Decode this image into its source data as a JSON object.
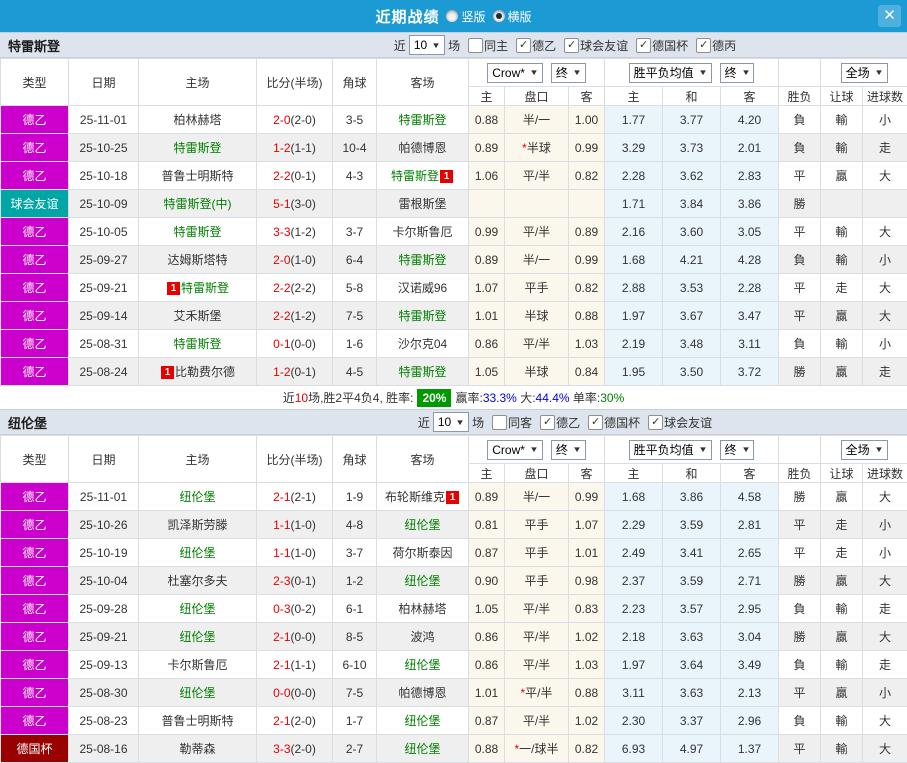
{
  "titlebar": {
    "title": "近期战绩",
    "view_options": [
      {
        "label": "竖版",
        "selected": false
      },
      {
        "label": "横版",
        "selected": true
      }
    ],
    "close_icon": "✕"
  },
  "colors": {
    "accent_blue": "#1c9ad4",
    "team_highlight_green": "#008000",
    "score_red": "#e60000",
    "result_red": "#e60000",
    "result_green": "#008000",
    "result_blue": "#0000dd",
    "rate_badge_green": "#009900",
    "league_colors": {
      "德乙": "#cc00cc",
      "球会友谊": "#00a6a6",
      "德国杯": "#990000"
    },
    "result_colors": {
      "勝": "red",
      "負": "green",
      "平": "blue",
      "贏": "red",
      "輸": "green",
      "走": "blue",
      "大": "red",
      "小": "green"
    }
  },
  "table_header": {
    "main_cols": [
      "类型",
      "日期",
      "主场",
      "比分(半场)",
      "角球",
      "客场"
    ],
    "odds_dropdown": "Crow*",
    "odds_final_dropdown": "终",
    "avg_dropdown": "胜平负均值",
    "avg_final_dropdown": "终",
    "scope_dropdown": "全场",
    "sub_cols": [
      "主",
      "盘口",
      "客",
      "主",
      "和",
      "客",
      "胜负",
      "让球",
      "进球数"
    ]
  },
  "sections": [
    {
      "team": "特雷斯登",
      "filters": {
        "near_label": "近",
        "matches_value": "10",
        "matches_suffix": "场",
        "venue": {
          "label": "同主",
          "checked": false
        },
        "leagues": [
          {
            "label": "德乙",
            "checked": true
          },
          {
            "label": "球会友谊",
            "checked": true
          },
          {
            "label": "德国杯",
            "checked": true
          },
          {
            "label": "德丙",
            "checked": true
          }
        ]
      },
      "rows": [
        {
          "league": "德乙",
          "date": "25-11-01",
          "home": {
            "name": "柏林赫塔",
            "highlight": false
          },
          "score": "2-0",
          "half": "(2-0)",
          "corners": "3-5",
          "away": {
            "name": "特雷斯登",
            "highlight": true
          },
          "odds": [
            "0.88",
            "半/一",
            "1.00"
          ],
          "avg": [
            "1.77",
            "3.77",
            "4.20"
          ],
          "results": [
            "負",
            "輸",
            "小"
          ]
        },
        {
          "league": "德乙",
          "date": "25-10-25",
          "home": {
            "name": "特雷斯登",
            "highlight": true
          },
          "score": "1-2",
          "half": "(1-1)",
          "corners": "10-4",
          "away": {
            "name": "帕德博恩",
            "highlight": false
          },
          "odds": [
            "0.89",
            "*半球",
            "0.99"
          ],
          "avg": [
            "3.29",
            "3.73",
            "2.01"
          ],
          "results": [
            "負",
            "輸",
            "走"
          ]
        },
        {
          "league": "德乙",
          "date": "25-10-18",
          "home": {
            "name": "普鲁士明斯特",
            "highlight": false
          },
          "score": "2-2",
          "half": "(0-1)",
          "corners": "4-3",
          "away": {
            "name": "特雷斯登",
            "highlight": true,
            "badge": "1",
            "badge_position": "after"
          },
          "odds": [
            "1.06",
            "平/半",
            "0.82"
          ],
          "avg": [
            "2.28",
            "3.62",
            "2.83"
          ],
          "results": [
            "平",
            "贏",
            "大"
          ]
        },
        {
          "league": "球会友谊",
          "date": "25-10-09",
          "home": {
            "name": "特雷斯登(中)",
            "highlight": true
          },
          "score": "5-1",
          "half": "(3-0)",
          "corners": "",
          "away": {
            "name": "雷根斯堡",
            "highlight": false
          },
          "odds": [
            "",
            "",
            ""
          ],
          "avg": [
            "1.71",
            "3.84",
            "3.86"
          ],
          "results": [
            "勝",
            "",
            ""
          ]
        },
        {
          "league": "德乙",
          "date": "25-10-05",
          "home": {
            "name": "特雷斯登",
            "highlight": true
          },
          "score": "3-3",
          "half": "(1-2)",
          "corners": "3-7",
          "away": {
            "name": "卡尔斯鲁厄",
            "highlight": false
          },
          "odds": [
            "0.99",
            "平/半",
            "0.89"
          ],
          "avg": [
            "2.16",
            "3.60",
            "3.05"
          ],
          "results": [
            "平",
            "輸",
            "大"
          ]
        },
        {
          "league": "德乙",
          "date": "25-09-27",
          "home": {
            "name": "达姆斯塔特",
            "highlight": false
          },
          "score": "2-0",
          "half": "(1-0)",
          "corners": "6-4",
          "away": {
            "name": "特雷斯登",
            "highlight": true
          },
          "odds": [
            "0.89",
            "半/一",
            "0.99"
          ],
          "avg": [
            "1.68",
            "4.21",
            "4.28"
          ],
          "results": [
            "負",
            "輸",
            "小"
          ]
        },
        {
          "league": "德乙",
          "date": "25-09-21",
          "home": {
            "name": "特雷斯登",
            "highlight": true,
            "badge": "1",
            "badge_position": "before"
          },
          "score": "2-2",
          "half": "(2-2)",
          "corners": "5-8",
          "away": {
            "name": "汉诺威96",
            "highlight": false
          },
          "odds": [
            "1.07",
            "平手",
            "0.82"
          ],
          "avg": [
            "2.88",
            "3.53",
            "2.28"
          ],
          "results": [
            "平",
            "走",
            "大"
          ]
        },
        {
          "league": "德乙",
          "date": "25-09-14",
          "home": {
            "name": "艾禾斯堡",
            "highlight": false
          },
          "score": "2-2",
          "half": "(1-2)",
          "corners": "7-5",
          "away": {
            "name": "特雷斯登",
            "highlight": true
          },
          "odds": [
            "1.01",
            "半球",
            "0.88"
          ],
          "avg": [
            "1.97",
            "3.67",
            "3.47"
          ],
          "results": [
            "平",
            "贏",
            "大"
          ]
        },
        {
          "league": "德乙",
          "date": "25-08-31",
          "home": {
            "name": "特雷斯登",
            "highlight": true
          },
          "score": "0-1",
          "half": "(0-0)",
          "corners": "1-6",
          "away": {
            "name": "沙尔克04",
            "highlight": false
          },
          "odds": [
            "0.86",
            "平/半",
            "1.03"
          ],
          "avg": [
            "2.19",
            "3.48",
            "3.11"
          ],
          "results": [
            "負",
            "輸",
            "小"
          ]
        },
        {
          "league": "德乙",
          "date": "25-08-24",
          "home": {
            "name": "比勒费尔德",
            "highlight": false,
            "badge": "1",
            "badge_position": "before"
          },
          "score": "1-2",
          "half": "(0-1)",
          "corners": "4-5",
          "away": {
            "name": "特雷斯登",
            "highlight": true
          },
          "odds": [
            "1.05",
            "半球",
            "0.84"
          ],
          "avg": [
            "1.95",
            "3.50",
            "3.72"
          ],
          "results": [
            "勝",
            "贏",
            "走"
          ]
        }
      ],
      "summary": {
        "parts": [
          {
            "text": "近",
            "color": "#333333"
          },
          {
            "text": "10",
            "color": "#e60000"
          },
          {
            "text": "场,胜2平4负4, 胜率:",
            "color": "#333333"
          },
          {
            "text": "20%",
            "style": "badge"
          },
          {
            "text": "赢率:",
            "color": "#333333"
          },
          {
            "text": "33.3%",
            "color": "#0000dd"
          },
          {
            "text": " 大:",
            "color": "#333333"
          },
          {
            "text": "44.4%",
            "color": "#0000dd"
          },
          {
            "text": " 单率:",
            "color": "#333333"
          },
          {
            "text": "30%",
            "color": "#008000"
          }
        ]
      }
    },
    {
      "team": "纽伦堡",
      "filters": {
        "near_label": "近",
        "matches_value": "10",
        "matches_suffix": "场",
        "venue": {
          "label": "同客",
          "checked": false
        },
        "leagues": [
          {
            "label": "德乙",
            "checked": true
          },
          {
            "label": "德国杯",
            "checked": true
          },
          {
            "label": "球会友谊",
            "checked": true
          }
        ]
      },
      "rows": [
        {
          "league": "德乙",
          "date": "25-11-01",
          "home": {
            "name": "纽伦堡",
            "highlight": true
          },
          "score": "2-1",
          "half": "(2-1)",
          "corners": "1-9",
          "away": {
            "name": "布轮斯维克",
            "highlight": false,
            "badge": "1",
            "badge_position": "after"
          },
          "odds": [
            "0.89",
            "半/一",
            "0.99"
          ],
          "avg": [
            "1.68",
            "3.86",
            "4.58"
          ],
          "results": [
            "勝",
            "贏",
            "大"
          ]
        },
        {
          "league": "德乙",
          "date": "25-10-26",
          "home": {
            "name": "凯泽斯劳滕",
            "highlight": false
          },
          "score": "1-1",
          "half": "(1-0)",
          "corners": "4-8",
          "away": {
            "name": "纽伦堡",
            "highlight": true
          },
          "odds": [
            "0.81",
            "平手",
            "1.07"
          ],
          "avg": [
            "2.29",
            "3.59",
            "2.81"
          ],
          "results": [
            "平",
            "走",
            "小"
          ]
        },
        {
          "league": "德乙",
          "date": "25-10-19",
          "home": {
            "name": "纽伦堡",
            "highlight": true
          },
          "score": "1-1",
          "half": "(1-0)",
          "corners": "3-7",
          "away": {
            "name": "荷尔斯泰因",
            "highlight": false
          },
          "odds": [
            "0.87",
            "平手",
            "1.01"
          ],
          "avg": [
            "2.49",
            "3.41",
            "2.65"
          ],
          "results": [
            "平",
            "走",
            "小"
          ]
        },
        {
          "league": "德乙",
          "date": "25-10-04",
          "home": {
            "name": "杜塞尔多夫",
            "highlight": false
          },
          "score": "2-3",
          "half": "(0-1)",
          "corners": "1-2",
          "away": {
            "name": "纽伦堡",
            "highlight": true
          },
          "odds": [
            "0.90",
            "平手",
            "0.98"
          ],
          "avg": [
            "2.37",
            "3.59",
            "2.71"
          ],
          "results": [
            "勝",
            "贏",
            "大"
          ]
        },
        {
          "league": "德乙",
          "date": "25-09-28",
          "home": {
            "name": "纽伦堡",
            "highlight": true
          },
          "score": "0-3",
          "half": "(0-2)",
          "corners": "6-1",
          "away": {
            "name": "柏林赫塔",
            "highlight": false
          },
          "odds": [
            "1.05",
            "平/半",
            "0.83"
          ],
          "avg": [
            "2.23",
            "3.57",
            "2.95"
          ],
          "results": [
            "負",
            "輸",
            "走"
          ]
        },
        {
          "league": "德乙",
          "date": "25-09-21",
          "home": {
            "name": "纽伦堡",
            "highlight": true
          },
          "score": "2-1",
          "half": "(0-0)",
          "corners": "8-5",
          "away": {
            "name": "波鸿",
            "highlight": false
          },
          "odds": [
            "0.86",
            "平/半",
            "1.02"
          ],
          "avg": [
            "2.18",
            "3.63",
            "3.04"
          ],
          "results": [
            "勝",
            "贏",
            "大"
          ]
        },
        {
          "league": "德乙",
          "date": "25-09-13",
          "home": {
            "name": "卡尔斯鲁厄",
            "highlight": false
          },
          "score": "2-1",
          "half": "(1-1)",
          "corners": "6-10",
          "away": {
            "name": "纽伦堡",
            "highlight": true
          },
          "odds": [
            "0.86",
            "平/半",
            "1.03"
          ],
          "avg": [
            "1.97",
            "3.64",
            "3.49"
          ],
          "results": [
            "負",
            "輸",
            "走"
          ]
        },
        {
          "league": "德乙",
          "date": "25-08-30",
          "home": {
            "name": "纽伦堡",
            "highlight": true
          },
          "score": "0-0",
          "half": "(0-0)",
          "corners": "7-5",
          "away": {
            "name": "帕德博恩",
            "highlight": false
          },
          "odds": [
            "1.01",
            "*平/半",
            "0.88"
          ],
          "avg": [
            "3.11",
            "3.63",
            "2.13"
          ],
          "results": [
            "平",
            "贏",
            "小"
          ]
        },
        {
          "league": "德乙",
          "date": "25-08-23",
          "home": {
            "name": "普鲁士明斯特",
            "highlight": false
          },
          "score": "2-1",
          "half": "(2-0)",
          "corners": "1-7",
          "away": {
            "name": "纽伦堡",
            "highlight": true
          },
          "odds": [
            "0.87",
            "平/半",
            "1.02"
          ],
          "avg": [
            "2.30",
            "3.37",
            "2.96"
          ],
          "results": [
            "負",
            "輸",
            "大"
          ]
        },
        {
          "league": "德国杯",
          "date": "25-08-16",
          "home": {
            "name": "勒蒂森",
            "highlight": false
          },
          "score": "3-3",
          "half": "(2-0)",
          "corners": "2-7",
          "away": {
            "name": "纽伦堡",
            "highlight": true
          },
          "odds": [
            "0.88",
            "*一/球半",
            "0.82"
          ],
          "avg": [
            "6.93",
            "4.97",
            "1.37"
          ],
          "results": [
            "平",
            "輸",
            "大"
          ]
        }
      ]
    }
  ]
}
